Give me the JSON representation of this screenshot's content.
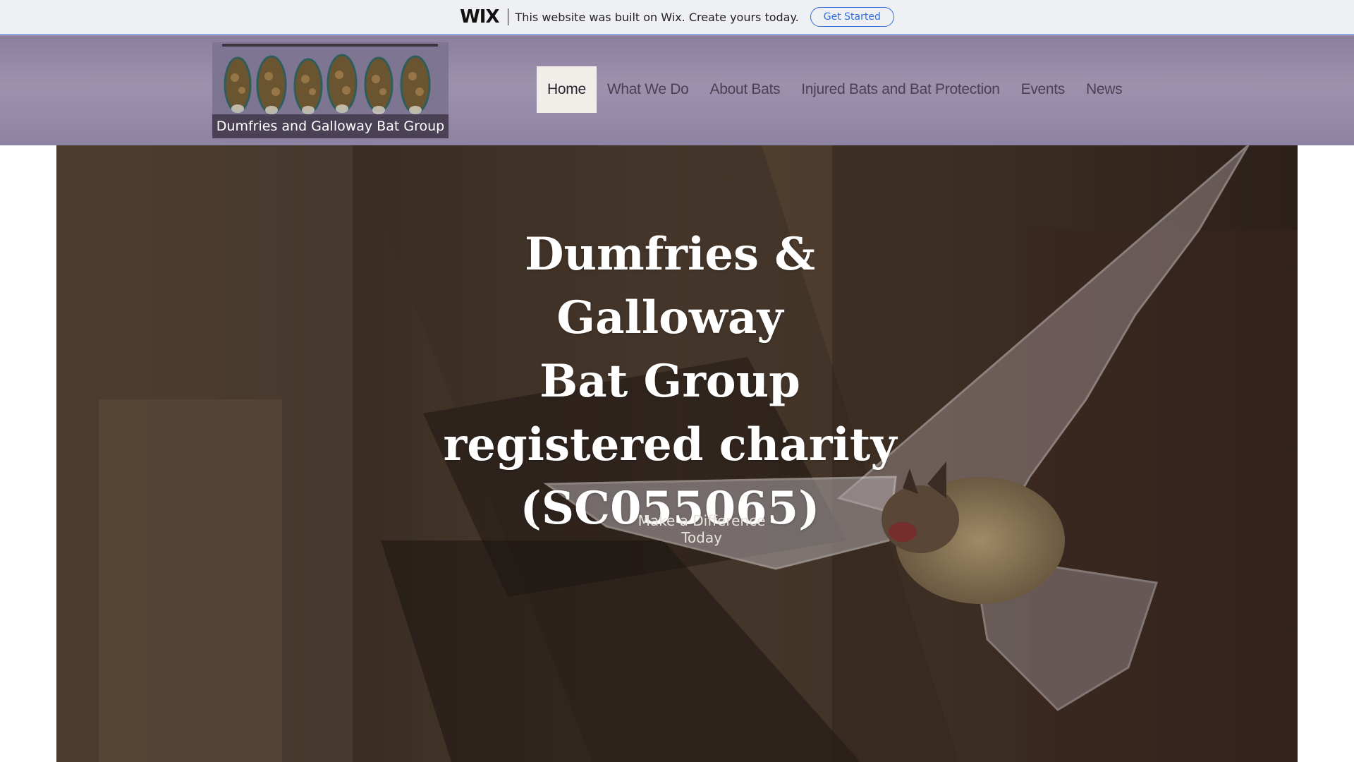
{
  "banner": {
    "logo": "WIX",
    "message": "This website was built on Wix. Create yours today.",
    "cta_label": "Get Started",
    "accent_color": "#2f6fde"
  },
  "header": {
    "logo_caption": "Dumfries and Galloway Bat Group",
    "nav": [
      {
        "label": "Home",
        "active": true
      },
      {
        "label": "What We Do",
        "active": false
      },
      {
        "label": "About Bats",
        "active": false
      },
      {
        "label": "Injured Bats and Bat Protection",
        "active": false
      },
      {
        "label": "Events",
        "active": false
      },
      {
        "label": "News",
        "active": false
      }
    ],
    "background_color": "#9d92ae"
  },
  "hero": {
    "title_lines": [
      "Dumfries & Galloway",
      "Bat Group",
      "registered charity",
      "(SC055065)"
    ],
    "cta_label": "Make a Difference Today",
    "image_subject": "bat-in-flight-photo"
  }
}
